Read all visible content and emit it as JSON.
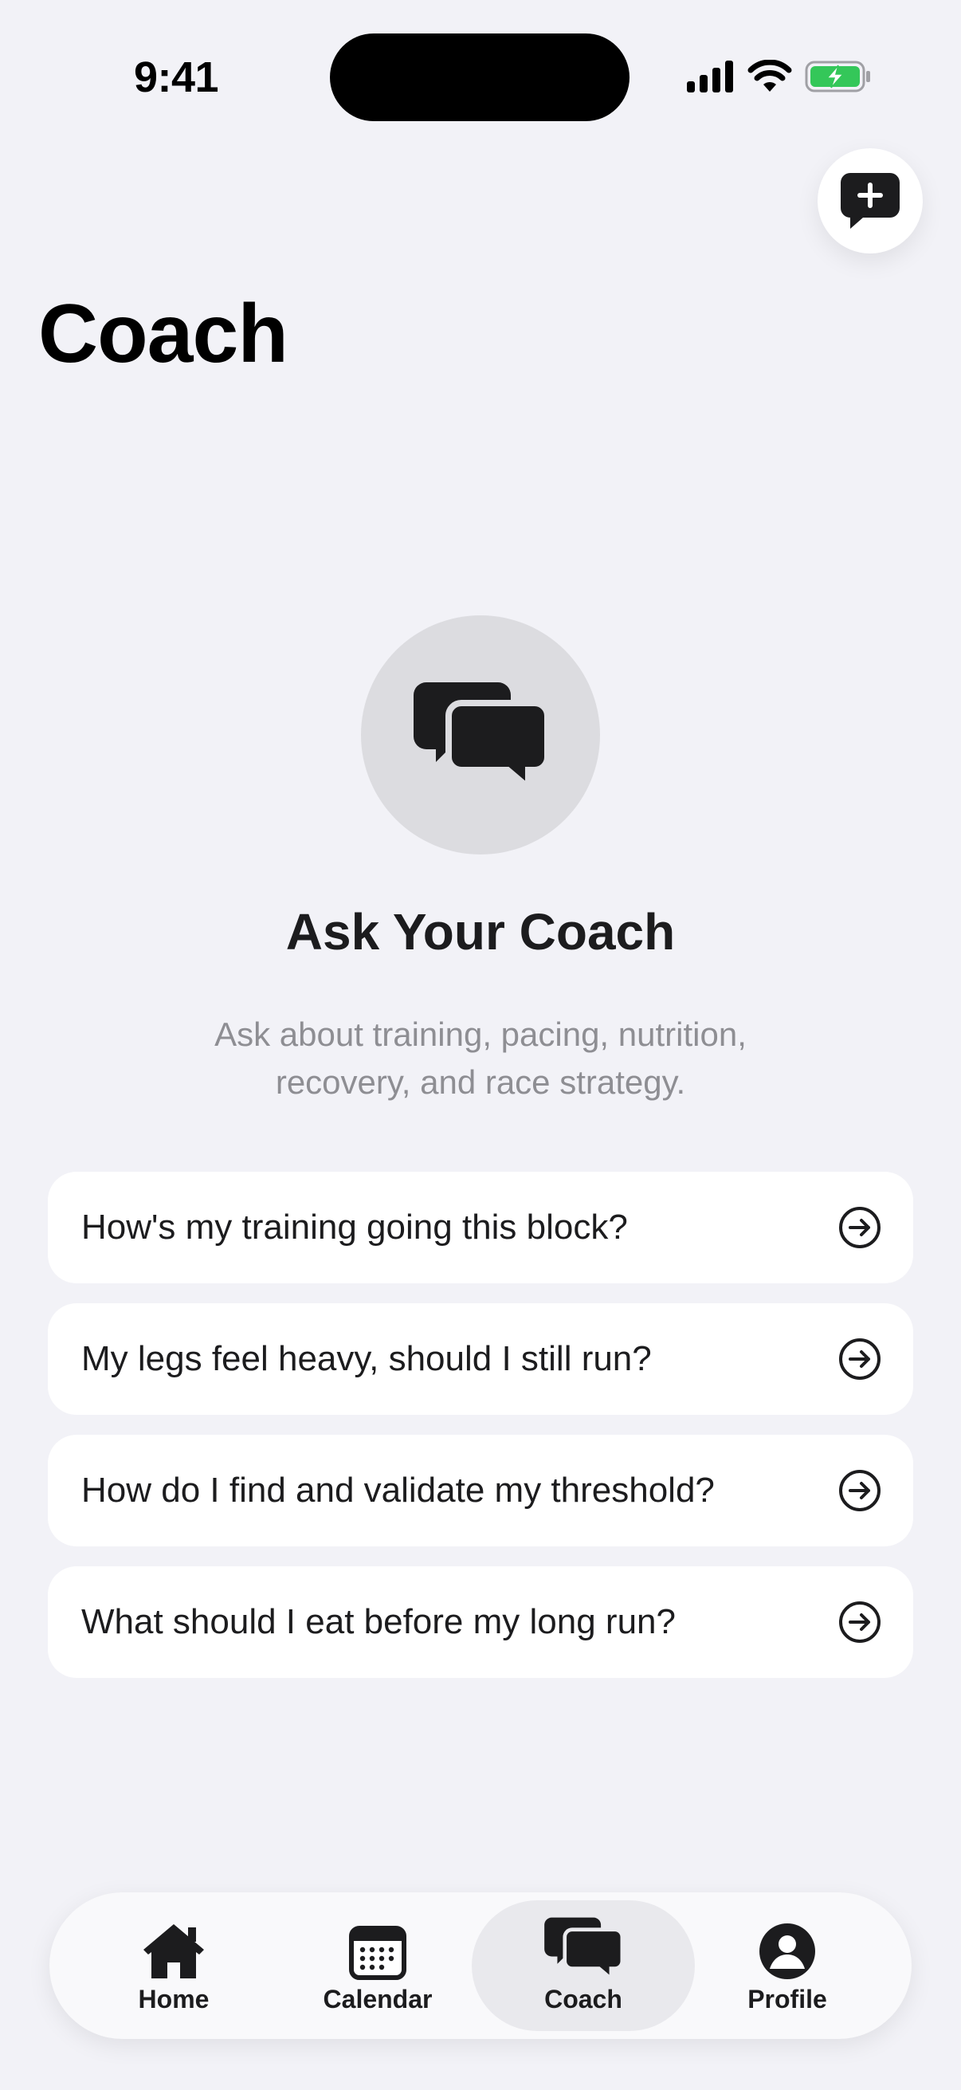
{
  "status_bar": {
    "time": "9:41",
    "signal_icon": "cellular-signal-icon",
    "wifi_icon": "wifi-icon",
    "battery_icon": "battery-charging-icon",
    "battery_color": "#34C759"
  },
  "header": {
    "title": "Coach",
    "new_chat_icon": "new-chat-icon"
  },
  "empty_state": {
    "icon": "chat-bubbles-icon",
    "title": "Ask Your Coach",
    "subtitle": "Ask about training, pacing, nutrition, recovery, and race strategy."
  },
  "suggestions": [
    {
      "text": "How's my training going this block?",
      "icon": "arrow-right-circle-icon"
    },
    {
      "text": "My legs feel heavy, should I still run?",
      "icon": "arrow-right-circle-icon"
    },
    {
      "text": "How do I find and validate my threshold?",
      "icon": "arrow-right-circle-icon"
    },
    {
      "text": "What should I eat before my long run?",
      "icon": "arrow-right-circle-icon"
    }
  ],
  "tab_bar": {
    "tabs": [
      {
        "label": "Home",
        "icon": "house-icon",
        "active": false
      },
      {
        "label": "Calendar",
        "icon": "calendar-icon",
        "active": false
      },
      {
        "label": "Coach",
        "icon": "chat-bubbles-icon",
        "active": true
      },
      {
        "label": "Profile",
        "icon": "person-circle-icon",
        "active": false
      }
    ]
  }
}
